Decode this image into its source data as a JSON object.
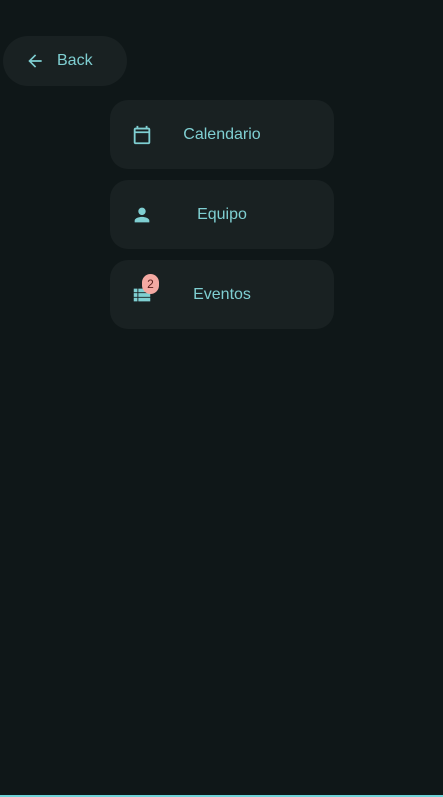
{
  "back": {
    "label": "Back",
    "icon": "arrow-left-icon"
  },
  "nav": {
    "items": [
      {
        "label": "Calendario",
        "icon": "calendar-icon"
      },
      {
        "label": "Equipo",
        "icon": "person-icon"
      },
      {
        "label": "Eventos",
        "icon": "list-icon",
        "badge": "2"
      }
    ]
  },
  "colors": {
    "background": "#0f1718",
    "card": "#192122",
    "accent": "#7fcfd2",
    "badge": "#f4a9a2"
  }
}
